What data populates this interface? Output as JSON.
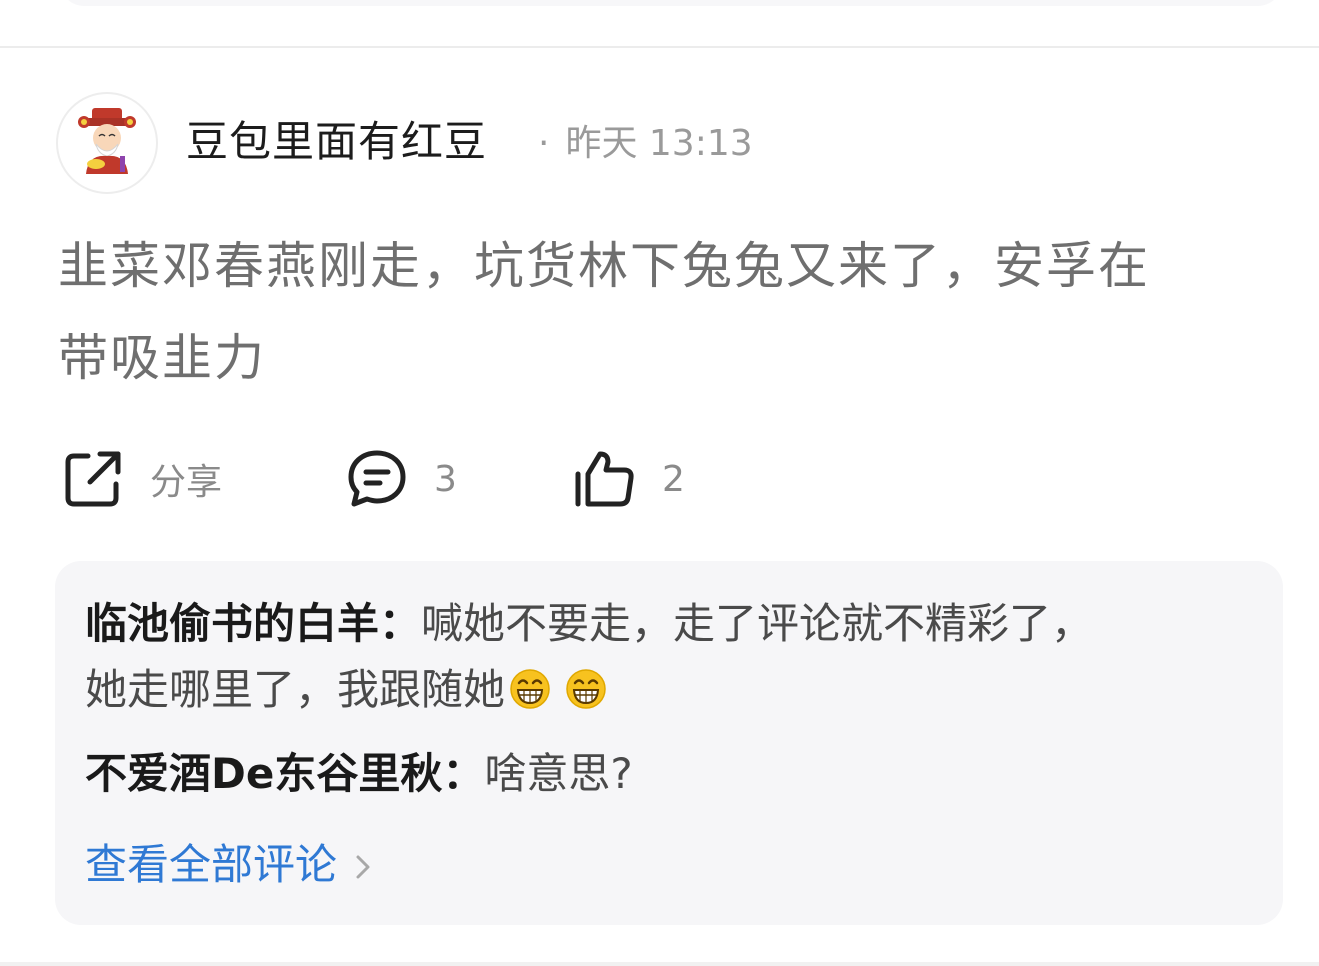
{
  "post": {
    "author": "豆包里面有红豆",
    "separator": "·",
    "time": "昨天 13:13",
    "content_line1": "韭菜邓春燕刚走，坑货林下兔兔又来了，安孚在",
    "content_line2": "带吸韭力"
  },
  "actions": {
    "share_label": "分享",
    "comment_count": "3",
    "like_count": "2"
  },
  "comments": [
    {
      "name": "临池偷书的白羊：",
      "text_line1": "喊她不要走，走了评论就不精彩了，",
      "text_line2": "她走哪里了，我跟随她",
      "emojis": [
        "grin-emoji",
        "grin-emoji"
      ]
    },
    {
      "name": "不爱酒De东谷里秋：",
      "text_line1": "啥意思?"
    }
  ],
  "view_all_label": "查看全部评论",
  "colors": {
    "link": "#2f79d4",
    "comment_bg": "#f6f6f8",
    "content_text": "#6f6f6f",
    "meta_text": "#9a9a9a"
  }
}
